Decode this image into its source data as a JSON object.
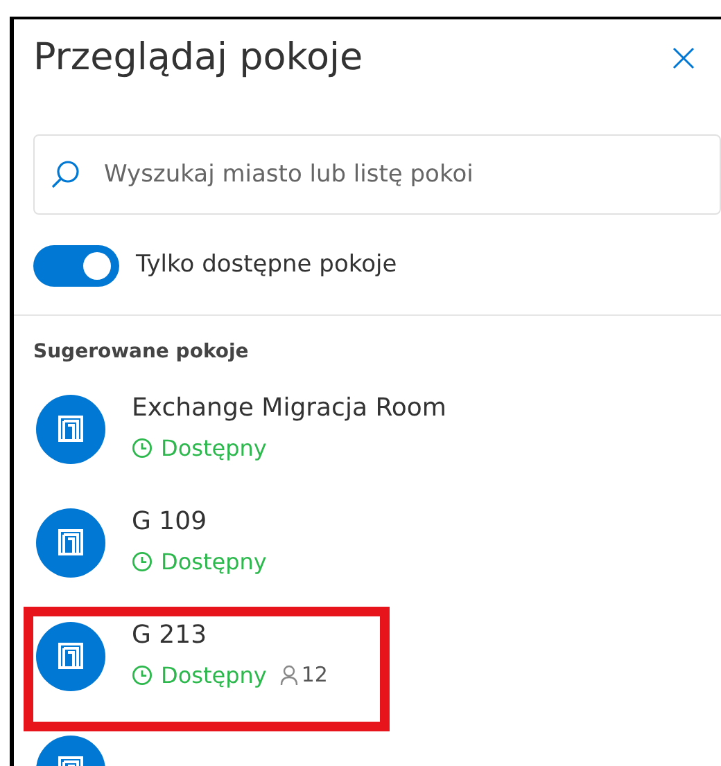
{
  "panel": {
    "title": "Przeglądaj pokoje"
  },
  "search": {
    "placeholder": "Wyszukaj miasto lub listę pokoi"
  },
  "toggle": {
    "label": "Tylko dostępne pokoje",
    "on": true
  },
  "section_title": "Sugerowane pokoje",
  "rooms": [
    {
      "name": "Exchange Migracja Room",
      "status": "Dostępny",
      "highlighted": false
    },
    {
      "name": "G 109",
      "status": "Dostępny",
      "highlighted": false
    },
    {
      "name": "G 213",
      "status": "Dostępny",
      "capacity": "12",
      "highlighted": true
    },
    {
      "highlighted": false
    }
  ]
}
